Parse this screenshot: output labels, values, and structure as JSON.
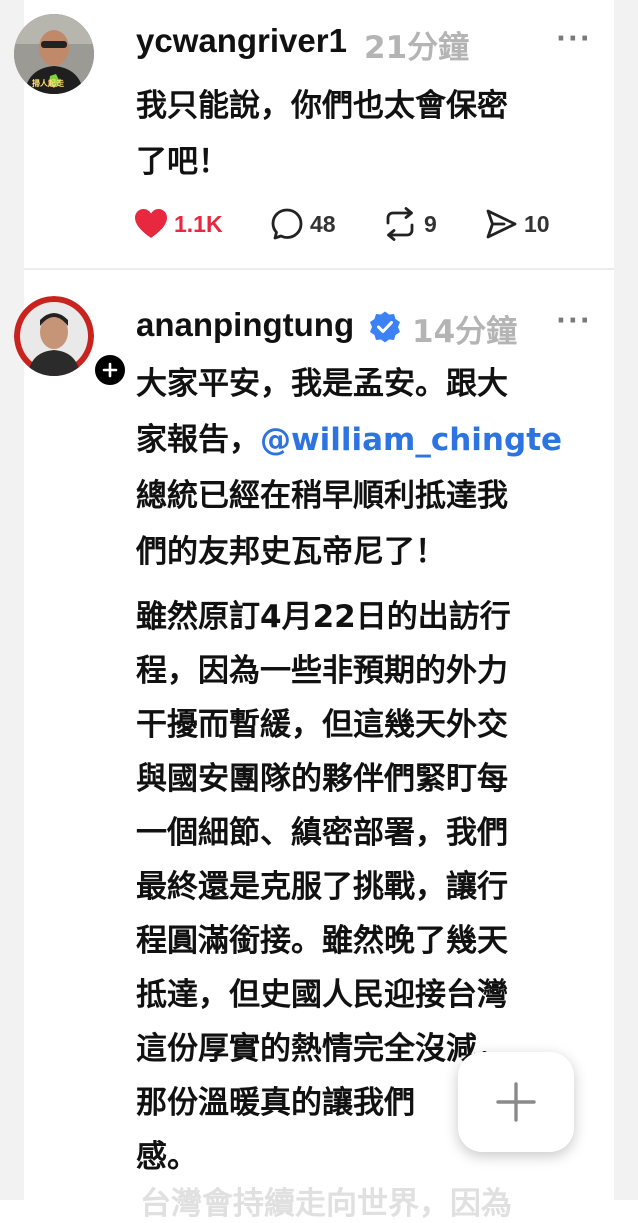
{
  "post1": {
    "username": "ycwangriver1",
    "time": "21分鐘",
    "more": "···",
    "avatar_caption": "掃人起走",
    "text_lines": [
      "我只能說，你們也太會保密",
      "了吧！"
    ],
    "like_count": "1.1K",
    "reply_count": "48",
    "repost_count": "9",
    "share_count": "10",
    "like_color": "#e8283f"
  },
  "post2": {
    "username": "ananpingtung",
    "time": "14分鐘",
    "more": "···",
    "verified_color": "#3b82f6",
    "line1": "大家平安，我是孟安。跟大",
    "line2_prefix": "家報告，",
    "mention": "@william_chingte",
    "line3": "總統已經在稍早順利抵達我",
    "line4": "們的友邦史瓦帝尼了！",
    "paragraph2_lines": [
      "雖然原訂4月22日的出訪行",
      "程，因為一些非預期的外力",
      "干擾而暫緩，但這幾天外交",
      "與國安團隊的夥伴們緊盯每",
      "一個細節、縝密部署，我們",
      "最終還是克服了挑戰，讓行",
      "程圓滿銜接。雖然晚了幾天",
      "抵達，但史國人民迎接台灣",
      "這份厚實的熱情完全沒減，",
      "那份溫暖真的讓我們",
      "感。"
    ],
    "faded_line": "台灣會持續走向世界，因為"
  },
  "colors": {
    "mention": "#2e74e0",
    "muted": "#b4b4b4"
  },
  "icons": {
    "like": "heart-icon",
    "reply": "speech-bubble-icon",
    "repost": "repost-icon",
    "share": "send-icon",
    "compose": "plus-icon",
    "verified": "verified-badge-icon",
    "follow": "follow-plus-icon"
  }
}
